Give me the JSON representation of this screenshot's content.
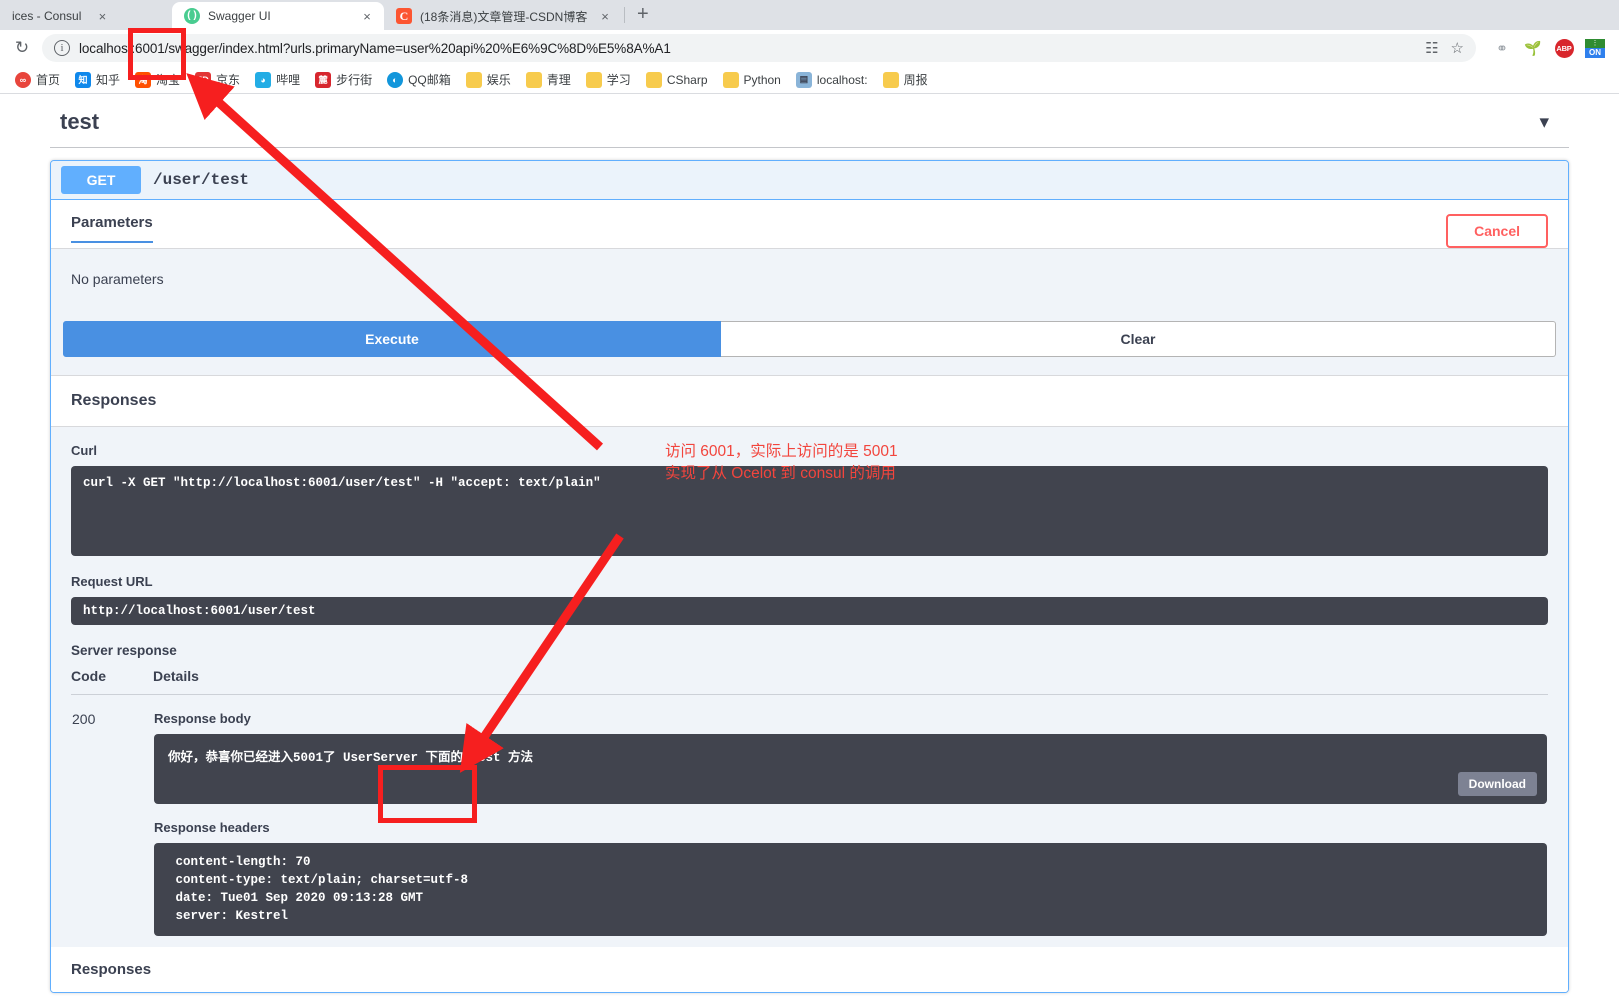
{
  "browser": {
    "tabs": [
      {
        "title": "ices - Consul",
        "favicon": "consul-icon",
        "active": false,
        "close_label": "×"
      },
      {
        "title": "Swagger UI",
        "favicon": "swagger-icon",
        "active": true,
        "close_label": "×"
      },
      {
        "title": "(18条消息)文章管理-CSDN博客",
        "favicon": "csdn-icon",
        "active": false,
        "close_label": "×"
      }
    ],
    "new_tab_label": "+",
    "reload_label": "↻",
    "omnibox": {
      "info_label": "i",
      "url": "localhost:6001/swagger/index.html?urls.primaryName=user%20api%20%E6%9C%8D%E5%8A%A1",
      "translate_icon": "translate-icon",
      "bookmark_icon": "star-icon"
    },
    "extensions": [
      {
        "name": "proxy-switchy-icon",
        "glyph": "⚭"
      },
      {
        "name": "sprout-icon",
        "glyph": "🌱"
      },
      {
        "name": "adblock-plus-icon",
        "glyph": "ABP"
      },
      {
        "name": "https-everywhere-on-icon",
        "glyph": "ON"
      }
    ],
    "bookmarks": [
      {
        "label": "首页",
        "icon": "infinity-icon",
        "glyph": "∞",
        "color": "#e8453c",
        "round": true
      },
      {
        "label": "知乎",
        "icon": "zhihu-icon",
        "glyph": "知",
        "color": "#0f88eb",
        "round": false
      },
      {
        "label": "淘宝",
        "icon": "taobao-icon",
        "glyph": "淘",
        "color": "#ff5000",
        "round": false
      },
      {
        "label": "京东",
        "icon": "jd-icon",
        "glyph": "JD",
        "color": "#e23535",
        "round": false
      },
      {
        "label": "哔哩",
        "icon": "bilibili-icon",
        "glyph": "◕",
        "color": "#23ade5",
        "round": false
      },
      {
        "label": "步行街",
        "icon": "hupu-icon",
        "glyph": "麓",
        "color": "#d7262e",
        "round": false
      },
      {
        "label": "QQ邮箱",
        "icon": "qqmail-icon",
        "glyph": "◐",
        "color": "#1296db",
        "round": true
      },
      {
        "label": "娱乐",
        "icon": "folder-icon",
        "glyph": "",
        "color": "#f7cb4d",
        "round": false
      },
      {
        "label": "青理",
        "icon": "folder-icon",
        "glyph": "",
        "color": "#f7cb4d",
        "round": false
      },
      {
        "label": "学习",
        "icon": "folder-icon",
        "glyph": "",
        "color": "#f7cb4d",
        "round": false
      },
      {
        "label": "CSharp",
        "icon": "folder-icon",
        "glyph": "",
        "color": "#f7cb4d",
        "round": false
      },
      {
        "label": "Python",
        "icon": "folder-icon",
        "glyph": "",
        "color": "#f7cb4d",
        "round": false
      },
      {
        "label": "localhost:",
        "icon": "page-icon",
        "glyph": "▤",
        "color": "#8ab4d8",
        "round": false
      },
      {
        "label": "周报",
        "icon": "folder-icon",
        "glyph": "",
        "color": "#f7cb4d",
        "round": false
      }
    ]
  },
  "swagger": {
    "tag_title": "test",
    "collapse_icon": "chevron-down-icon",
    "operation": {
      "method": "GET",
      "path": "/user/test",
      "tab_label": "Parameters",
      "cancel_label": "Cancel",
      "no_parameters": "No parameters",
      "execute_label": "Execute",
      "clear_label": "Clear"
    },
    "responses_heading": "Responses",
    "responses_footer": "Responses",
    "curl_label": "Curl",
    "curl_command": "curl -X GET \"http://localhost:6001/user/test\" -H \"accept: text/plain\"",
    "request_url_label": "Request URL",
    "request_url": "http://localhost:6001/user/test",
    "server_response_label": "Server response",
    "table_headers": {
      "code": "Code",
      "details": "Details"
    },
    "response_row": {
      "code": "200",
      "response_body_label": "Response body",
      "response_body": "你好，恭喜你已经进入5001了 UserServer 下面的 test 方法",
      "download_label": "Download",
      "response_headers_label": "Response headers",
      "response_headers": " content-length: 70 \n content-type: text/plain; charset=utf-8 \n date: Tue01 Sep 2020 09:13:28 GMT \n server: Kestrel"
    }
  },
  "annotations": {
    "note_line1": "访问 6001，实际上访问的是 5001",
    "note_line2": "实现了从 Ocelot 到 consul 的调用",
    "color": "#f2453d"
  }
}
